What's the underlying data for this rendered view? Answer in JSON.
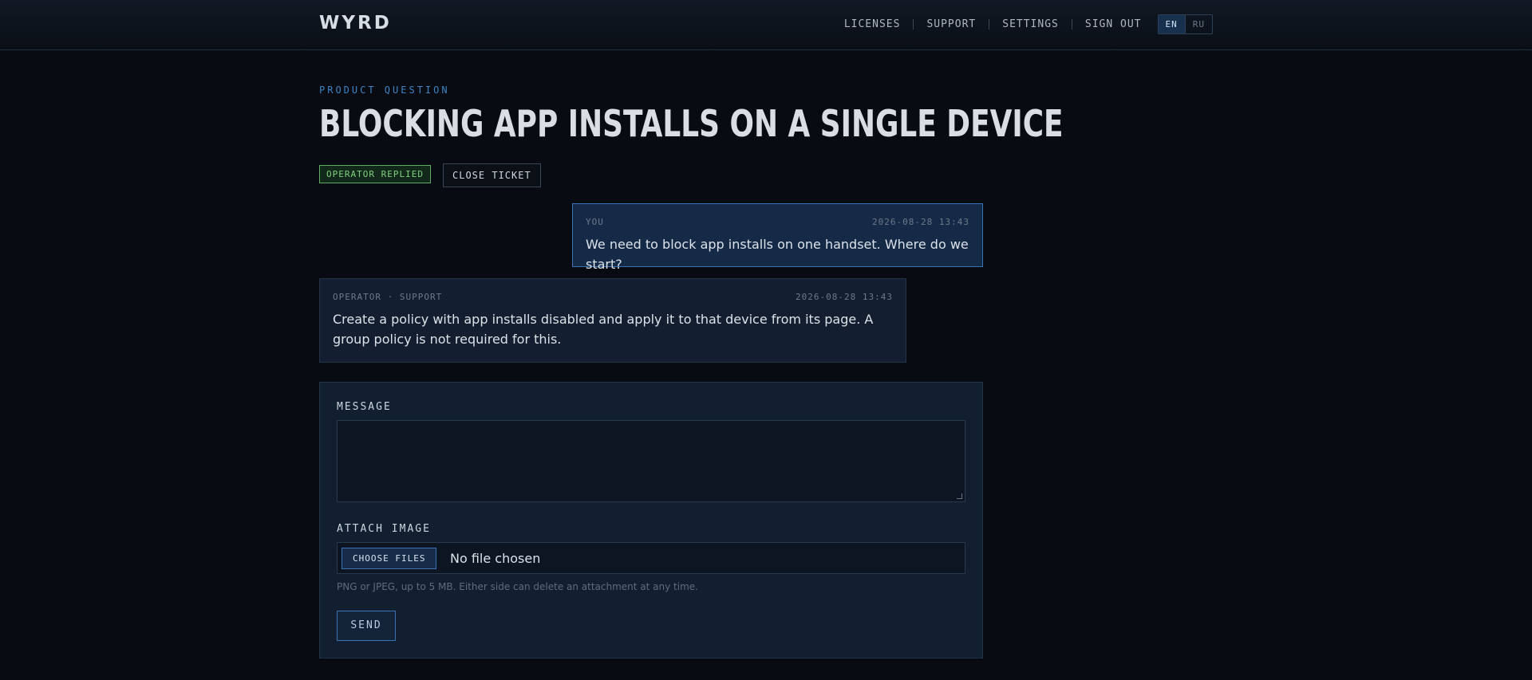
{
  "header": {
    "brand": "WYRD",
    "nav": [
      "LICENSES",
      "SUPPORT",
      "SETTINGS",
      "SIGN OUT"
    ],
    "lang": {
      "active": "EN",
      "inactive": "RU"
    }
  },
  "ticket": {
    "category": "PRODUCT QUESTION",
    "title": "BLOCKING APP INSTALLS ON A SINGLE DEVICE",
    "status": "OPERATOR REPLIED",
    "close_label": "CLOSE TICKET"
  },
  "messages": [
    {
      "author": "YOU",
      "time": "2026-08-28 13:43",
      "body": "We need to block app installs on one handset. Where do we start?"
    },
    {
      "author": "OPERATOR · SUPPORT",
      "time": "2026-08-28 13:43",
      "body": "Create a policy with app installs disabled and apply it to that device from its page. A group policy is not required for this."
    }
  ],
  "form": {
    "message_label": "MESSAGE",
    "message_value": "",
    "attach_label": "ATTACH IMAGE",
    "choose_label": "CHOOSE FILES",
    "no_file": "No file chosen",
    "hint": "PNG or JPEG, up to 5 MB. Either side can delete an attachment at any time.",
    "send_label": "SEND"
  },
  "colors": {
    "background": "#080c12",
    "accent": "#3973b4",
    "status_green": "#7fd07f"
  }
}
